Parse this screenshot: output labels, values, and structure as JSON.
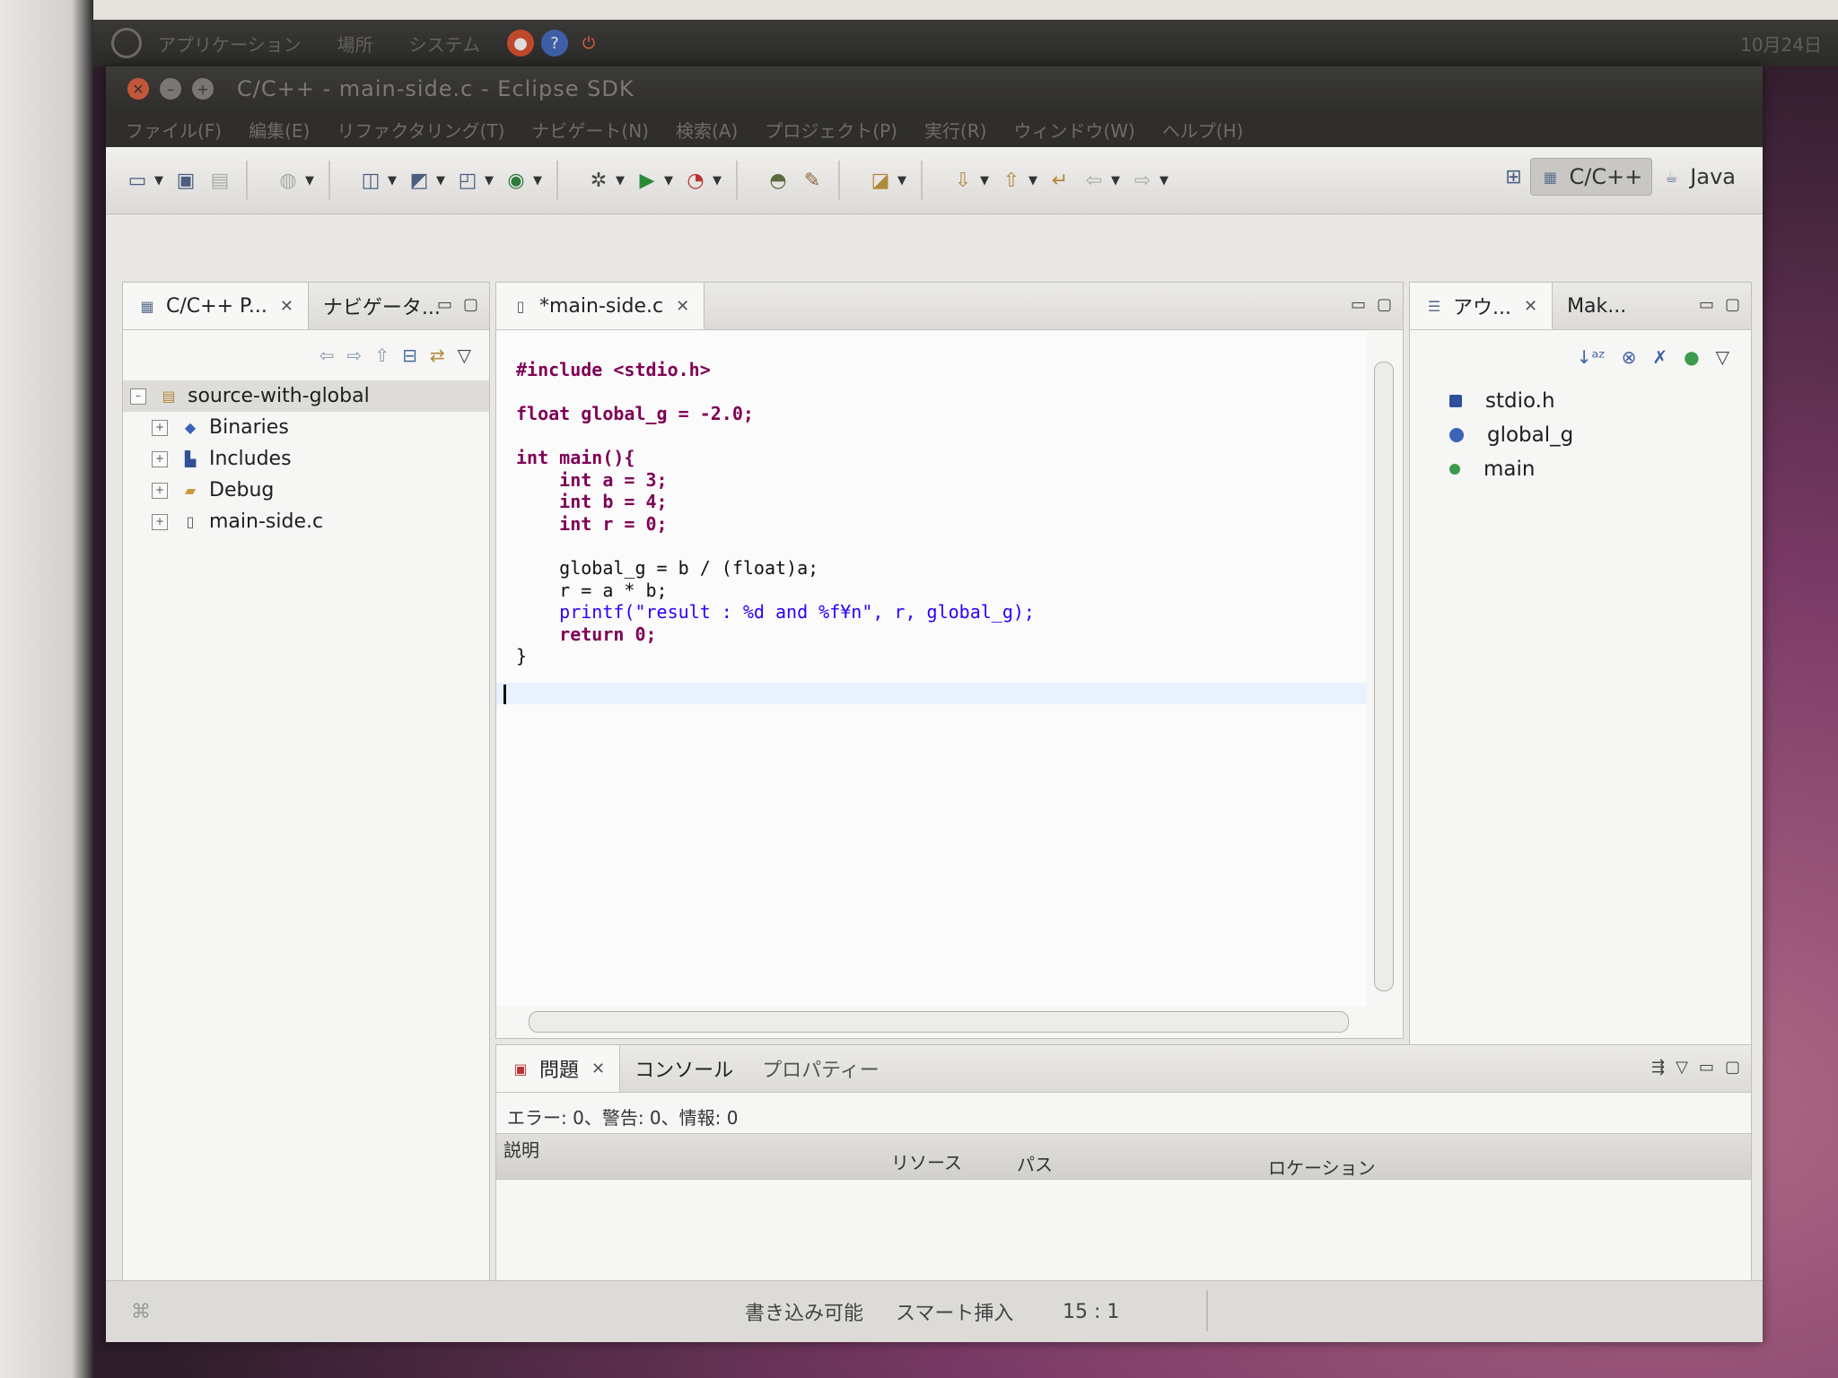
{
  "panel": {
    "menus": [
      "アプリケーション",
      "場所",
      "システム"
    ],
    "clock": "10月24日"
  },
  "window": {
    "title": "C/C++ - main-side.c - Eclipse SDK",
    "menus": [
      "ファイル(F)",
      "編集(E)",
      "リファクタリング(T)",
      "ナビゲート(N)",
      "検索(A)",
      "プロジェクト(P)",
      "実行(R)",
      "ウィンドウ(W)",
      "ヘルプ(H)"
    ]
  },
  "perspectives": {
    "cpp": "C/C++",
    "java": "Java"
  },
  "explorer": {
    "tab_active": "C/C++ P...",
    "tab_other": "ナビゲータ...",
    "project": "source-with-global",
    "items": [
      {
        "label": "Binaries",
        "icon": "binaries-icon"
      },
      {
        "label": "Includes",
        "icon": "includes-icon"
      },
      {
        "label": "Debug",
        "icon": "folder-icon"
      },
      {
        "label": "main-side.c",
        "icon": "c-file-icon"
      }
    ]
  },
  "editor": {
    "tab": "*main-side.c",
    "code": [
      "#include <stdio.h>",
      "",
      "float global_g = -2.0;",
      "",
      "int main(){",
      "    int a = 3;",
      "    int b = 4;",
      "    int r = 0;",
      "",
      "    global_g = b / (float)a;",
      "    r = a * b;",
      "    printf(\"result : %d and %f¥n\", r, global_g);",
      "    return 0;",
      "}"
    ]
  },
  "outline": {
    "tab_active": "アウ...",
    "tab_other": "Mak...",
    "items": [
      {
        "label": "stdio.h",
        "color": "#2f4f9a"
      },
      {
        "label": "global_g",
        "color": "#3a63b8"
      },
      {
        "label": "main",
        "color": "#3b9a4c"
      }
    ]
  },
  "problems": {
    "tabs": [
      "問題",
      "コンソール",
      "プロパティー"
    ],
    "summary": "エラー: 0、警告: 0、情報: 0",
    "columns": [
      "説明",
      "リソース",
      "パス",
      "ロケーション"
    ]
  },
  "status": {
    "writable": "書き込み可能",
    "insert_mode": "スマート挿入",
    "position": "15 : 1"
  }
}
